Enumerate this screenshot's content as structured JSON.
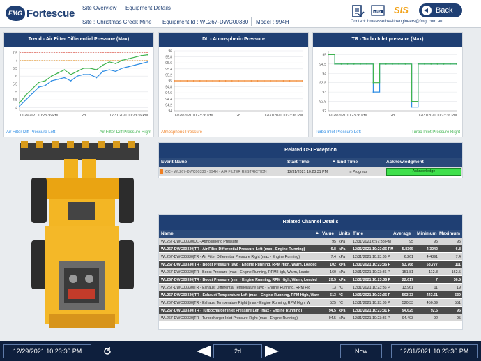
{
  "header": {
    "brand": "Fortescue",
    "logo_text": "FMG",
    "nav": [
      "Site Overview",
      "Equipment Details"
    ],
    "site": "Site : Christmas Creek Mine",
    "equipment_id": "Equipment Id : WL267-DWC00330",
    "model": "Model : 994H",
    "ems_label": "IEMS",
    "sis_label": "SIS",
    "back_label": "Back",
    "contact": "Contact: hmeassethealthengineers@fmgl.com.au"
  },
  "charts": [
    {
      "title": "Trend - Air Filter Differential Pressure (Max)",
      "yticks": [
        "7.5",
        "7",
        "6.5",
        "6",
        "5.5",
        "5",
        "4.5",
        "4"
      ],
      "xticks": [
        "12/29/2021 10:23:36 PM",
        "2d",
        "12/31/2021 10:23:36 PM"
      ],
      "legend": [
        "Air Filter Diff Pressure Left",
        "Air Filter Diff Pressure Right"
      ],
      "colors": [
        "#2f8de4",
        "#3fb34f"
      ]
    },
    {
      "title": "DL - Atmospheric Pressure",
      "yticks": [
        "96",
        "95.8",
        "95.6",
        "95.4",
        "95.2",
        "95",
        "94.8",
        "94.6",
        "94.4",
        "94.2",
        "94"
      ],
      "xticks": [
        "12/29/2021 10:23:36 PM",
        "2d",
        "12/31/2021 10:23:36 PM"
      ],
      "legend": [
        "Atmospheric Pressure"
      ],
      "colors": [
        "#f07f22"
      ]
    },
    {
      "title": "TR - Turbo Inlet pressure (Max)",
      "yticks": [
        "95",
        "94.5",
        "94",
        "93.5",
        "93",
        "92.5",
        "92"
      ],
      "xticks": [
        "12/29/2021 10:23:36 PM",
        "2d",
        "12/31/2021 10:23:36 PM"
      ],
      "legend": [
        "Turbo Inlet Pressure Left",
        "Turbo Inlet Pressure Right"
      ],
      "colors": [
        "#2f8de4",
        "#3fb34f"
      ]
    }
  ],
  "chart_data": [
    {
      "type": "line",
      "title": "Trend - Air Filter Differential Pressure (Max)",
      "ylim": [
        3.8,
        7.6
      ],
      "series": [
        {
          "name": "Air Filter Diff Pressure Left",
          "values": [
            4.1,
            4.5,
            4.9,
            5.3,
            5.4,
            5.7,
            5.8,
            5.9,
            5.7,
            6.0,
            6.1,
            6.1,
            5.9,
            6.3,
            6.4,
            6.3,
            6.5,
            6.6,
            6.7,
            6.8,
            6.9
          ]
        },
        {
          "name": "Air Filter Diff Pressure Right",
          "values": [
            4.3,
            4.8,
            5.2,
            5.6,
            5.7,
            6.0,
            6.2,
            6.4,
            6.1,
            6.3,
            6.5,
            6.5,
            6.4,
            6.7,
            6.9,
            6.8,
            7.0,
            7.1,
            7.2,
            7.3,
            7.35
          ]
        }
      ]
    },
    {
      "type": "line",
      "title": "DL - Atmospheric Pressure",
      "ylim": [
        94,
        96
      ],
      "series": [
        {
          "name": "Atmospheric Pressure",
          "values": [
            95,
            95,
            95,
            95,
            95,
            95,
            95,
            95,
            95,
            95,
            95,
            95,
            95,
            95,
            95,
            95,
            95,
            95,
            95,
            95,
            95
          ]
        }
      ]
    },
    {
      "type": "line",
      "title": "TR - Turbo Inlet pressure (Max)",
      "ylim": [
        92,
        95.2
      ],
      "series": [
        {
          "name": "Turbo Inlet Pressure Left",
          "values": [
            95,
            94.5,
            94.5,
            94.5,
            94.5,
            94.5,
            94.5,
            93,
            94.5,
            94.5,
            94.5,
            94.5,
            94.5,
            92.2,
            94.5,
            94.5,
            94.5,
            94.5,
            94.5,
            94.5,
            94.5
          ]
        },
        {
          "name": "Turbo Inlet Pressure Right",
          "values": [
            95,
            94.5,
            94.5,
            94.5,
            94.5,
            94.5,
            94.5,
            93.5,
            94.5,
            94.5,
            94.5,
            94.5,
            94.5,
            92.5,
            94.5,
            94.5,
            94.5,
            94.5,
            94.5,
            94.5,
            94.5
          ]
        }
      ]
    }
  ],
  "osi": {
    "title": "Related OSI Exception",
    "columns": [
      "Event Name",
      "Start Time",
      "End Time",
      "Acknowledgment"
    ],
    "rows": [
      {
        "event": "CC - WL267-DWC00330 - 994H - AIR FILTER RESTRICTION",
        "start": "12/31/2021 10:23:31 PM",
        "end": "In Progress",
        "ack": "Acknowledge"
      }
    ]
  },
  "channels": {
    "title": "Related Channel Details",
    "columns": [
      "Name",
      "Value",
      "Units",
      "Time",
      "Average",
      "Minimum",
      "Maximum"
    ],
    "rows": [
      {
        "name": "WL267-DWC00330|DL - Atmospheric Pressure",
        "value": "95",
        "units": "kPa",
        "time": "12/31/2021 6:57:38 PM",
        "avg": "95",
        "min": "95",
        "max": "95"
      },
      {
        "name": "WL267-DWC00330|TR - Air Filter Differential Pressure Left (max - Engine Running)",
        "value": "6.8",
        "units": "kPa",
        "time": "12/31/2021 10:23:36 PM",
        "avg": "5.8365",
        "min": "4.3242",
        "max": "6.8"
      },
      {
        "name": "WL267-DWC00330|TR - Air Filter Differential Pressure Right (max - Engine Running)",
        "value": "7.4",
        "units": "kPa",
        "time": "12/31/2021 10:23:36 P",
        "avg": "6.261",
        "min": "4.4891",
        "max": "7.4"
      },
      {
        "name": "WL267-DWC00330|TR - Boost Pressure (avg - Engine Running, RPM High, Warm, Loaded",
        "value": "102",
        "units": "kPa",
        "time": "12/31/2021 10:23:36 P",
        "avg": "93.768",
        "min": "58.777",
        "max": "111"
      },
      {
        "name": "WL267-DWC00330|TR - Boost Pressure (max - Engine Running, RPM High, Warm, Loade",
        "value": "160",
        "units": "kPa",
        "time": "12/31/2021 10:23:36 P",
        "avg": "151.81",
        "min": "112.8",
        "max": "162.5"
      },
      {
        "name": "WL267-DWC00330|TR - Boost Pressure (min - Engine Running, RPM High, Warm, Loaded",
        "value": "20.5",
        "units": "kPa",
        "time": "12/31/2021 10:23:36 P",
        "avg": "22.617",
        "min": "7",
        "max": "36.5"
      },
      {
        "name": "WL267-DWC00330|TR - Exhaust Differential Temperature (avg - Engine Running, RPM Hig",
        "value": "13",
        "units": "°C",
        "time": "12/31/2021 10:23:36 P",
        "avg": "13.961",
        "min": "11",
        "max": "19"
      },
      {
        "name": "WL267-DWC00330|TR - Exhaust Temperature Left (max - Engine Running, RPM High, Warm",
        "value": "513",
        "units": "°C",
        "time": "12/31/2021 10:23:36 P",
        "avg": "503.33",
        "min": "443.61",
        "max": "539"
      },
      {
        "name": "WL267-DWC00330|TR - Exhaust Temperature Right (max - Engine Running, RPM High, W",
        "value": "525",
        "units": "°C",
        "time": "12/31/2021 10:23:36 P",
        "avg": "520.33",
        "min": "450.69",
        "max": "551"
      },
      {
        "name": "WL267-DWC00330|TR - Turbocharger Inlet Pressure Left (max - Engine Running)",
        "value": "94.5",
        "units": "kPa",
        "time": "12/31/2021 10:23:31 P",
        "avg": "94.625",
        "min": "92.5",
        "max": "95"
      },
      {
        "name": "WL267-DWC00330|TR - Turbocharger Inlet Pressure Right (max - Engine Running)",
        "value": "94.5",
        "units": "kPa",
        "time": "12/31/2021 10:23:36 P",
        "avg": "94.493",
        "min": "92",
        "max": "95"
      }
    ]
  },
  "footer": {
    "start": "12/29/2021 10:23:36 PM",
    "range": "2d",
    "now": "Now",
    "end": "12/31/2021 10:23:36 PM"
  }
}
